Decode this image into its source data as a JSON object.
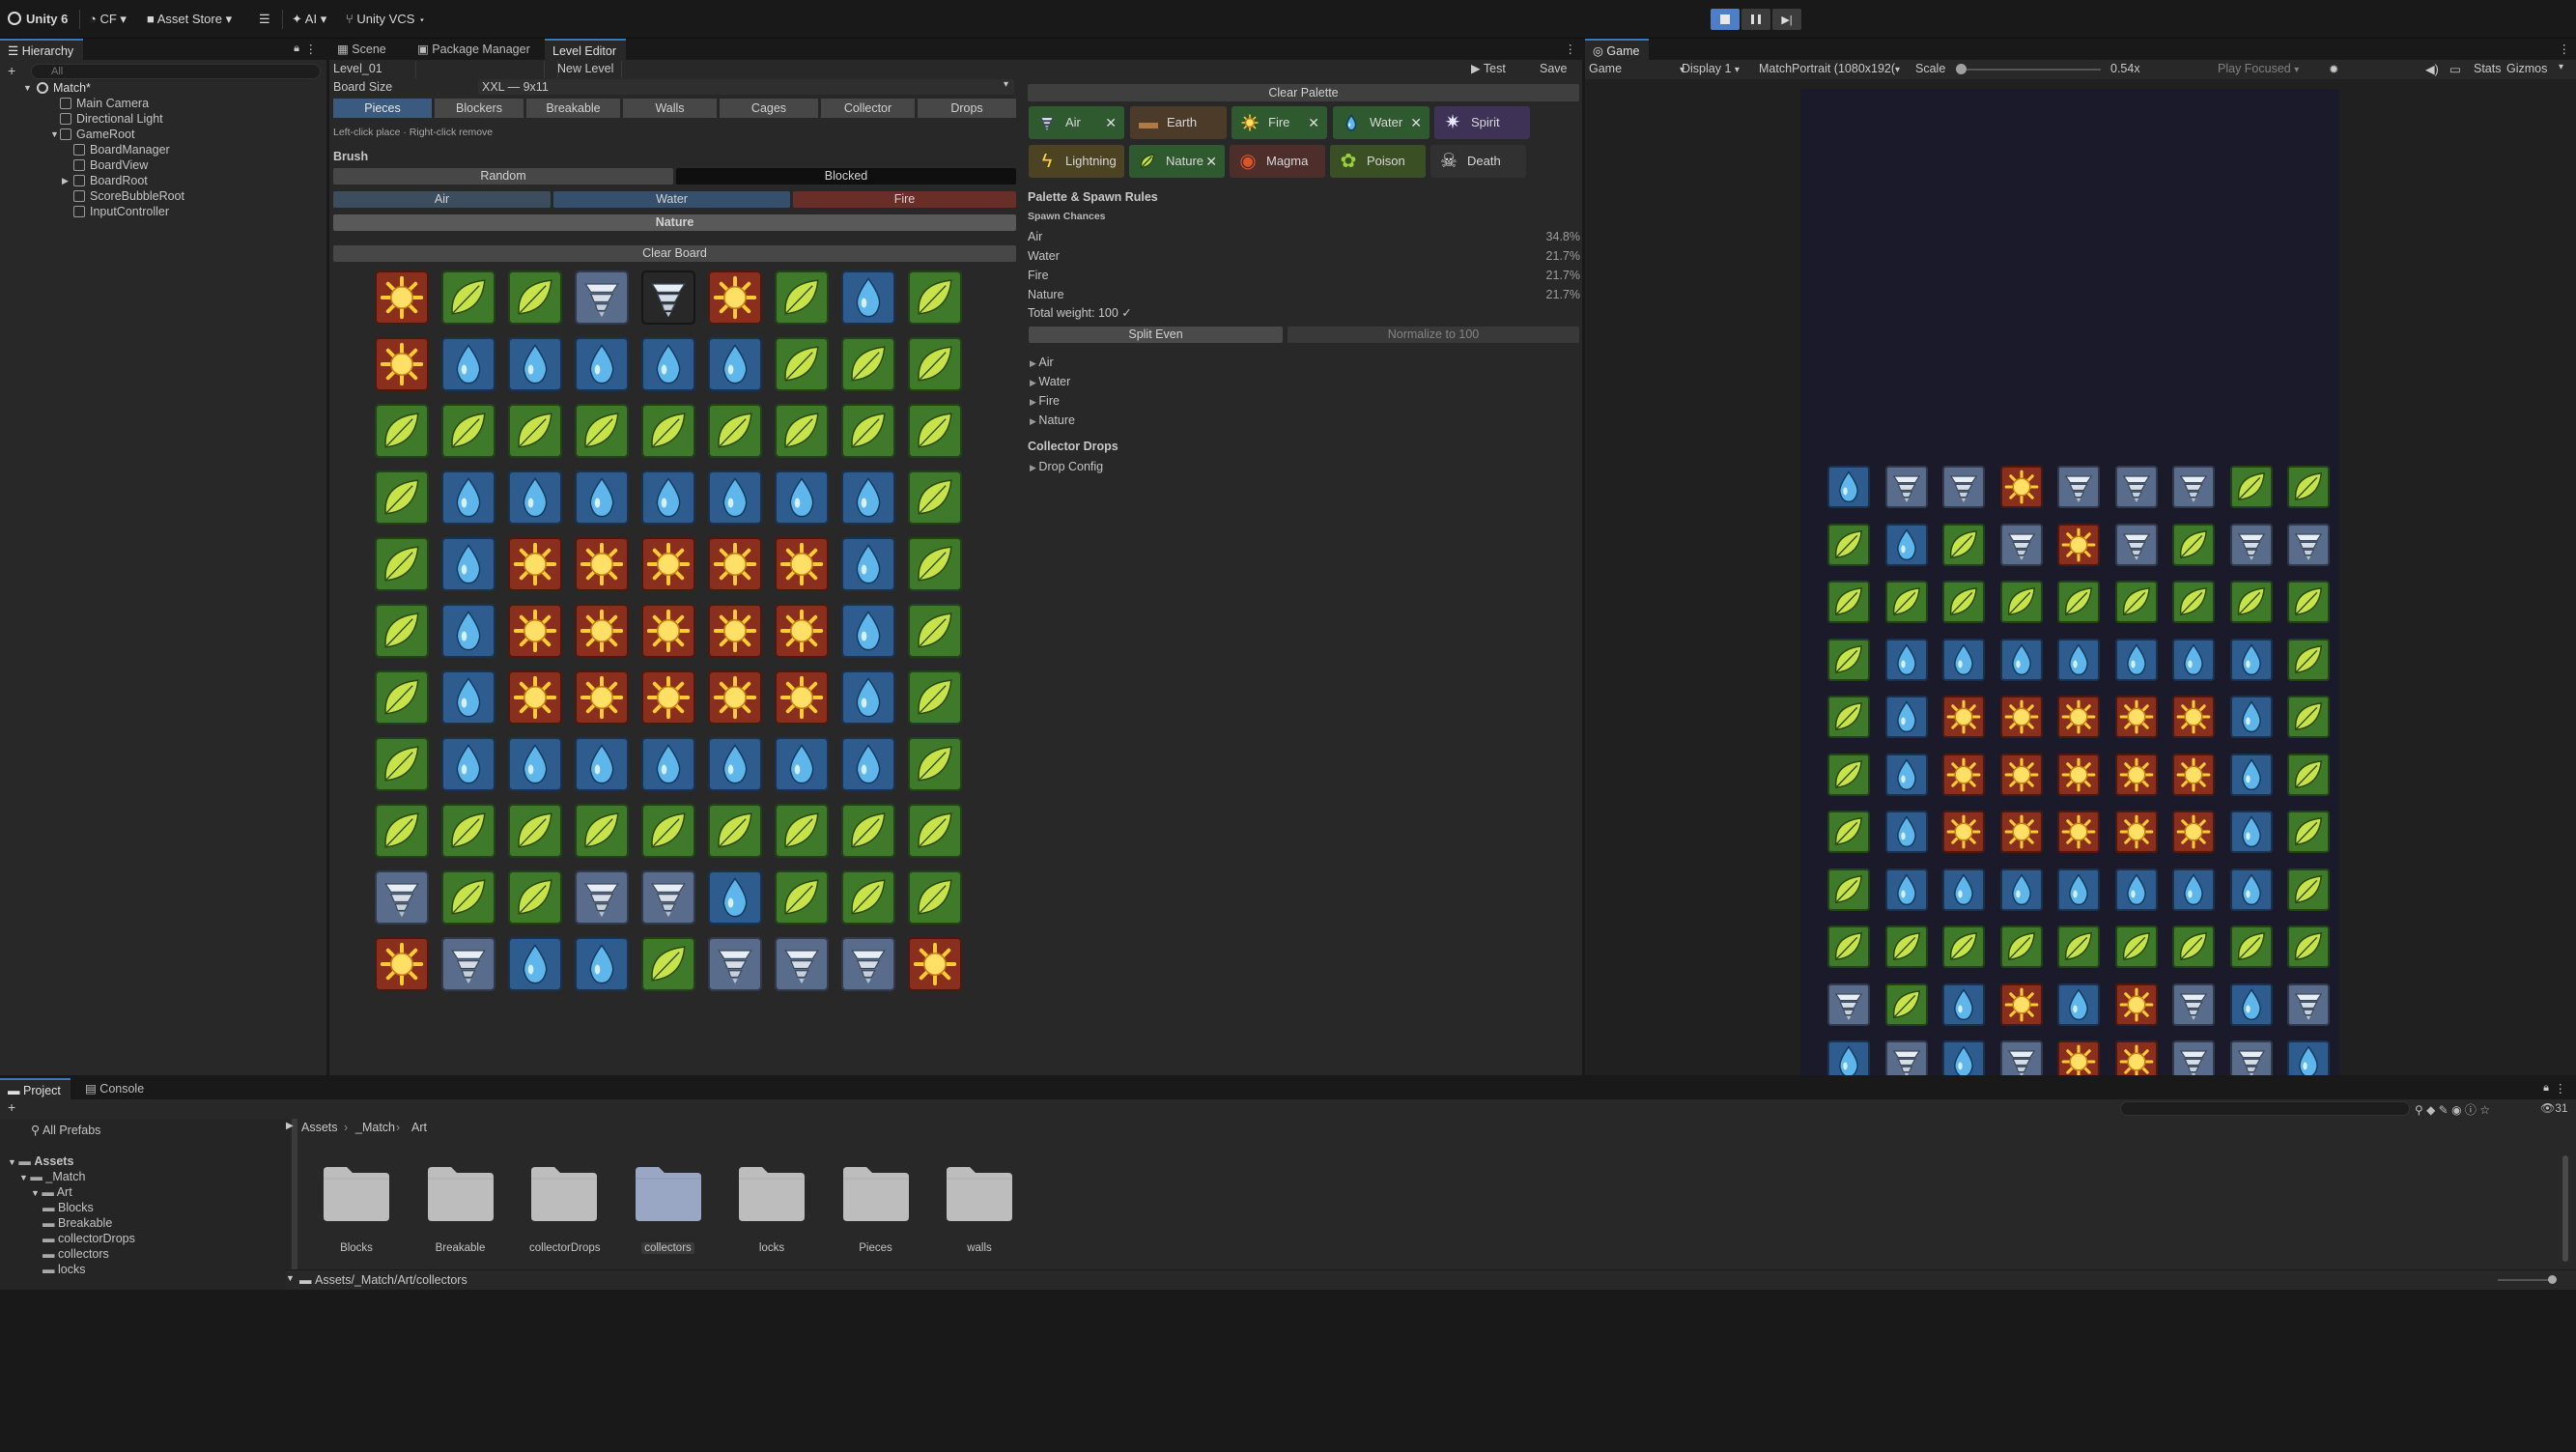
{
  "topbar": {
    "account": "Unity 6",
    "user": "CF",
    "asset_store": "Asset Store",
    "ai": "AI",
    "vcs": "Unity VCS"
  },
  "hierarchy": {
    "tab": "Hierarchy",
    "search_placeholder": "All",
    "scene": "Match*",
    "items": [
      {
        "label": "Main Camera",
        "depth": 1
      },
      {
        "label": "Directional Light",
        "depth": 1
      },
      {
        "label": "GameRoot",
        "depth": 1
      },
      {
        "label": "BoardManager",
        "depth": 2
      },
      {
        "label": "BoardView",
        "depth": 2
      },
      {
        "label": "BoardRoot",
        "depth": 2
      },
      {
        "label": "ScoreBubbleRoot",
        "depth": 2
      },
      {
        "label": "InputController",
        "depth": 2
      }
    ]
  },
  "editor": {
    "tabs": [
      "Scene",
      "Package Manager",
      "Level Editor"
    ],
    "level_name": "Level_01",
    "new_level": "New Level",
    "test": "Test",
    "save": "Save",
    "board_size_label": "Board Size",
    "board_size_value": "XXL — 9x11",
    "piece_tabs": [
      "Pieces",
      "Blockers",
      "Breakable",
      "Walls",
      "Cages",
      "Collector",
      "Drops"
    ],
    "hint": "Left-click place · Right-click remove",
    "brush_label": "Brush",
    "brush_random": "Random",
    "brush_blocked": "Blocked",
    "brush_air": "Air",
    "brush_water": "Water",
    "brush_fire": "Fire",
    "brush_nature": "Nature",
    "clear_board": "Clear Board",
    "board": [
      "FNNATFNWN",
      "FWWWWWNNN",
      "NNNNNNNNN",
      "NWWWWWWWN",
      "NWFFFFFWN",
      "NWFFFFFWN",
      "NWFFFFFWN",
      "NWWWWWWWN",
      "NNNNNNNNN",
      "ANNAAWNNN",
      "FAWWNAAAF"
    ]
  },
  "palette": {
    "clear": "Clear Palette",
    "items": [
      {
        "label": "Air",
        "removable": true,
        "color": "#2f5a30",
        "icon": "tornado-icon"
      },
      {
        "label": "Earth",
        "removable": false,
        "color": "#4d3b2a",
        "icon": "log-icon"
      },
      {
        "label": "Fire",
        "removable": true,
        "color": "#2f5a30",
        "icon": "sun-icon"
      },
      {
        "label": "Water",
        "removable": true,
        "color": "#2f5a30",
        "icon": "drop-icon"
      },
      {
        "label": "Spirit",
        "removable": false,
        "color": "#3e3356",
        "icon": "spirit-icon"
      },
      {
        "label": "Lightning",
        "removable": false,
        "color": "#4b4322",
        "icon": "bolt-icon"
      },
      {
        "label": "Nature",
        "removable": true,
        "color": "#2f5a30",
        "icon": "leaf-icon"
      },
      {
        "label": "Magma",
        "removable": false,
        "color": "#4d2e2a",
        "icon": "magma-icon"
      },
      {
        "label": "Poison",
        "removable": false,
        "color": "#3b4f25",
        "icon": "poison-icon"
      },
      {
        "label": "Death",
        "removable": false,
        "color": "#313131",
        "icon": "skull-icon"
      }
    ],
    "rules_title": "Palette & Spawn Rules",
    "spawn_title": "Spawn Chances",
    "spawn": [
      {
        "label": "Air",
        "value": "34.8%"
      },
      {
        "label": "Water",
        "value": "21.7%"
      },
      {
        "label": "Fire",
        "value": "21.7%"
      },
      {
        "label": "Nature",
        "value": "21.7%"
      }
    ],
    "total": "Total weight: 100 ✓",
    "split_even": "Split Even",
    "normalize": "Normalize to 100",
    "foldouts": [
      "Air",
      "Water",
      "Fire",
      "Nature"
    ],
    "collector_title": "Collector Drops",
    "drop_config": "Drop Config"
  },
  "game": {
    "tab": "Game",
    "mode": "Game",
    "display": "Display 1",
    "resolution": "MatchPortrait (1080x192(",
    "scale_label": "Scale",
    "scale_value": "0.54x",
    "play_focused": "Play Focused",
    "stats": "Stats",
    "gizmos": "Gizmos",
    "board": [
      "WAAFAAANN",
      "NWNAFANAA",
      "NNNNNNNNN",
      "NWWWWWWWN",
      "NWFFFFFWN",
      "NWFFFFFWN",
      "NWFFFFFWN",
      "NWWWWWWWN",
      "NNNNNNNNN",
      "ANWFWFAWA",
      "WAWAFFAAW"
    ]
  },
  "project": {
    "tabs": [
      "Project",
      "Console"
    ],
    "all_prefabs": "All Prefabs",
    "tree": [
      {
        "label": "Assets",
        "depth": 0
      },
      {
        "label": "_Match",
        "depth": 1
      },
      {
        "label": "Art",
        "depth": 2
      },
      {
        "label": "Blocks",
        "depth": 3
      },
      {
        "label": "Breakable",
        "depth": 3
      },
      {
        "label": "collectorDrops",
        "depth": 3
      },
      {
        "label": "collectors",
        "depth": 3
      },
      {
        "label": "locks",
        "depth": 3
      }
    ],
    "breadcrumb": [
      "Assets",
      "_Match",
      "Art"
    ],
    "folders": [
      "Blocks",
      "Breakable",
      "collectorDrops",
      "collectors",
      "locks",
      "Pieces",
      "walls"
    ],
    "selected_folder": "collectors",
    "path": "Assets/_Match/Art/collectors",
    "count": "31"
  },
  "colors": {
    "nature": "#3f7a2b",
    "water": "#2f5c8f",
    "fire": "#8a2f1e",
    "air": "#5a6c8c",
    "accent": "#3a79bb"
  }
}
